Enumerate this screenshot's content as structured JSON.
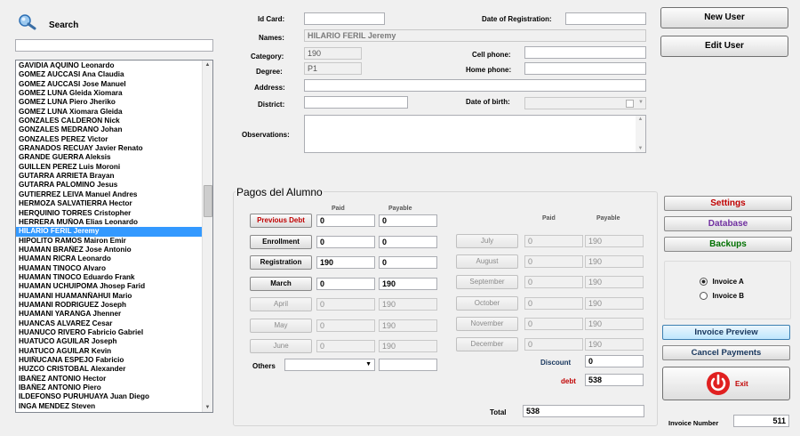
{
  "search": {
    "label": "Search",
    "value": ""
  },
  "students": [
    "GAVIDIA AQUINO Leonardo",
    "GOMEZ AUCCASI Ana Claudia",
    "GOMEZ AUCCASI Jose Manuel",
    "GOMEZ LUNA Gleida Xiomara",
    "GOMEZ LUNA Piero Jheriko",
    "GOMEZ LUNA Xiomara Gleida",
    "GONZALES CALDERON Nick",
    "GONZALES MEDRANO Johan",
    "GONZALES PEREZ Victor",
    "GRANADOS RECUAY Javier Renato",
    "GRANDE GUERRA Aleksis",
    "GUILLEN PEREZ Luis Moroni",
    "GUTARRA ARRIETA Brayan",
    "GUTARRA PALOMINO Jesus",
    "GUTIERREZ LEIVA Manuel Andres",
    "HERMOZA SALVATIERRA Hector",
    "HERQUINIO TORRES Cristopher",
    "HERRERA MUÑOA Elias Leonardo",
    "HILARIO FERIL Jeremy",
    "HIPOLITO RAMOS Mairon Emir",
    "HUAMAN BRAÑEZ Jose Antonio",
    "HUAMAN RICRA Leonardo",
    "HUAMAN TINOCO Alvaro",
    "HUAMAN TINOCO Eduardo Frank",
    "HUAMAN UCHUIPOMA Jhosep Farid",
    "HUAMANI HUAMANÑAHUI Mario",
    "HUAMANI RODRIGUEZ Joseph",
    "HUAMANI YARANGA Jhenner",
    "HUANCAS ALVAREZ Cesar",
    "HUANUCO RIVERO Fabricio Gabriel",
    "HUATUCO AGUILAR Joseph",
    "HUATUCO AGUILAR Kevin",
    "HUIÑUCANA ESPEJO Fabricio",
    "HUZCO CRISTOBAL Alexander",
    "IBAÑEZ ANTONIO Hector",
    "IBAÑEZ ANTONIO Piero",
    "ILDEFONSO PURUHUAYA Juan Diego",
    "INGA MENDEZ Steven"
  ],
  "selected_index": 18,
  "form": {
    "idcard_label": "Id Card:",
    "idcard_value": "",
    "registration_label": "Date of Registration:",
    "registration_value": "",
    "names_label": "Names:",
    "names_value": "HILARIO FERIL Jeremy",
    "category_label": "Category:",
    "category_value": "190",
    "cell_label": "Cell phone:",
    "cell_value": "",
    "degree_label": "Degree:",
    "degree_value": "P1",
    "home_label": "Home phone:",
    "home_value": "",
    "address_label": "Address:",
    "address_value": "",
    "district_label": "District:",
    "district_value": "",
    "dob_label": "Date of birth:",
    "dob_value": "",
    "obs_label": "Observations:",
    "obs_value": ""
  },
  "top_buttons": {
    "new_user": "New User",
    "edit_user": "Edit User"
  },
  "payments": {
    "title": "Pagos del Alumno",
    "paid_header": "Paid",
    "payable_header": "Payable",
    "left": [
      {
        "label": "Previous Debt",
        "paid": "0",
        "payable": "0"
      },
      {
        "label": "Enrollment",
        "paid": "0",
        "payable": "0"
      },
      {
        "label": "Registration",
        "paid": "190",
        "payable": "0"
      },
      {
        "label": "March",
        "paid": "0",
        "payable": "190"
      },
      {
        "label": "April",
        "paid": "0",
        "payable": "190"
      },
      {
        "label": "May",
        "paid": "0",
        "payable": "190"
      },
      {
        "label": "June",
        "paid": "0",
        "payable": "190"
      }
    ],
    "right": [
      {
        "label": "July",
        "paid": "0",
        "payable": "190"
      },
      {
        "label": "August",
        "paid": "0",
        "payable": "190"
      },
      {
        "label": "September",
        "paid": "0",
        "payable": "190"
      },
      {
        "label": "October",
        "paid": "0",
        "payable": "190"
      },
      {
        "label": "November",
        "paid": "0",
        "payable": "190"
      },
      {
        "label": "December",
        "paid": "0",
        "payable": "190"
      }
    ],
    "others_label": "Others",
    "others_value": "",
    "others_amount": "",
    "discount_label": "Discount",
    "discount_value": "0",
    "debt_label": "debt",
    "debt_value": "538",
    "total_label": "Total",
    "total_value": "538"
  },
  "side": {
    "settings": "Settings",
    "database": "Database",
    "backups": "Backups",
    "invoice_a": "Invoice A",
    "invoice_b": "Invoice B",
    "invoice_preview": "Invoice Preview",
    "cancel_payments": "Cancel Payments",
    "exit": "Exit",
    "invoice_number_label": "Invoice Number",
    "invoice_number_value": "511"
  },
  "colors": {
    "red": "#c00000",
    "purple": "#7030a0",
    "green": "#007000",
    "selection": "#3399ff"
  }
}
